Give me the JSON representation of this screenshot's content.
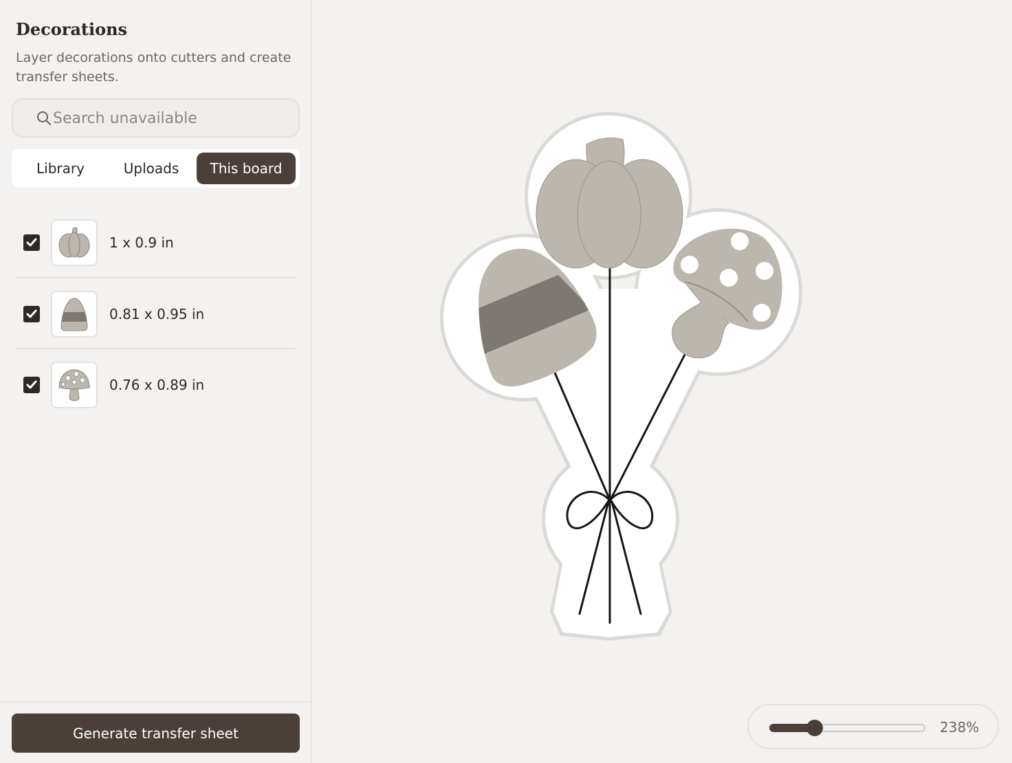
{
  "sidebar": {
    "title": "Decorations",
    "subtitle": "Layer decorations onto cutters and create transfer sheets.",
    "search": {
      "placeholder": "Search unavailable",
      "icon": "search-icon"
    },
    "tabs": [
      {
        "label": "Library",
        "active": false
      },
      {
        "label": "Uploads",
        "active": false
      },
      {
        "label": "This board",
        "active": true
      }
    ],
    "items": [
      {
        "name": "pumpkin",
        "icon": "pumpkin-icon",
        "checked": true,
        "dims": "1 x 0.9 in"
      },
      {
        "name": "candy-corn",
        "icon": "candy-corn-icon",
        "checked": true,
        "dims": "0.81 x 0.95 in"
      },
      {
        "name": "mushroom",
        "icon": "mushroom-icon",
        "checked": true,
        "dims": "0.76 x 0.89 in"
      }
    ],
    "generate_label": "Generate transfer sheet"
  },
  "zoom": {
    "value": 238,
    "label": "238%"
  },
  "colors": {
    "accent": "#4a3f39",
    "background": "#f3f2f0",
    "decoration_fill": "#bbb6ae",
    "stripe": "#7d7872"
  }
}
